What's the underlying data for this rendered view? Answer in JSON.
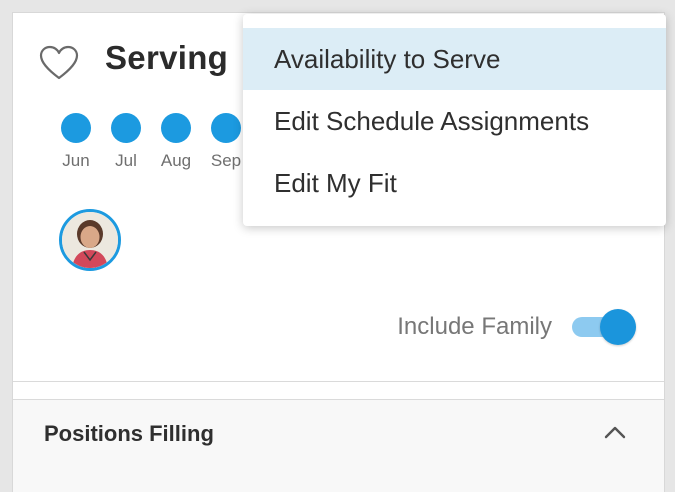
{
  "card": {
    "title": "Serving",
    "months": [
      "Jun",
      "Jul",
      "Aug",
      "Sep"
    ],
    "include_family_label": "Include Family",
    "include_family_on": true
  },
  "section": {
    "title": "Positions Filling"
  },
  "dropdown": {
    "items": [
      {
        "label": "Availability to Serve"
      },
      {
        "label": "Edit Schedule Assignments"
      },
      {
        "label": "Edit My Fit"
      }
    ]
  },
  "colors": {
    "accent": "#1c9ae0",
    "toggle_track": "#8dcaf0",
    "menu_highlight": "#dcedf6"
  },
  "icons": {
    "favorite": "heart-icon",
    "collapse": "chevron-up-icon"
  }
}
